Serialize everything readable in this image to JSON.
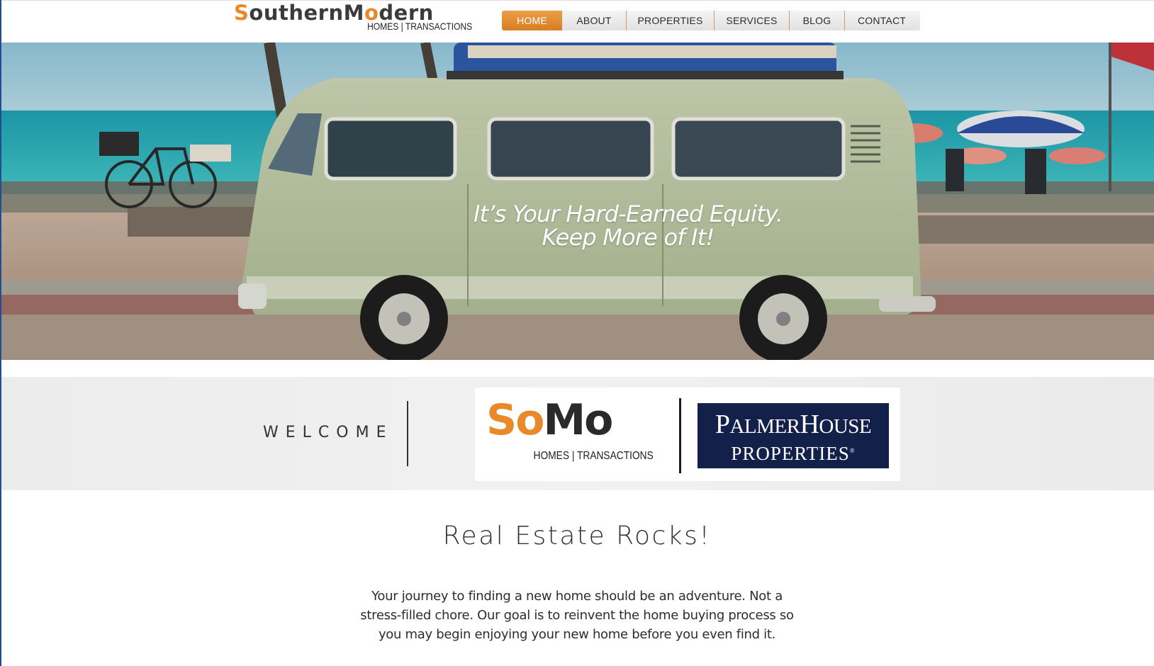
{
  "header": {
    "logo": {
      "word1_initial": "S",
      "word1_rest": "outhern",
      "word2_initial": "M",
      "word2_o": "o",
      "word2_rest": "dern",
      "tagline": "HOMES | TRANSACTIONS"
    },
    "nav": [
      {
        "label": "HOME",
        "active": true
      },
      {
        "label": "ABOUT",
        "active": false
      },
      {
        "label": "PROPERTIES",
        "active": false
      },
      {
        "label": "SERVICES",
        "active": false
      },
      {
        "label": "BLOG",
        "active": false
      },
      {
        "label": "CONTACT",
        "active": false
      }
    ]
  },
  "hero": {
    "line1": "It’s Your Hard-Earned Equity.",
    "line2": "Keep More of It!"
  },
  "welcome": {
    "label": "WELCOME",
    "somo": {
      "s": "S",
      "o1": "o",
      "m": "M",
      "o2": "o",
      "tagline": "HOMES | TRANSACTIONS"
    },
    "palmer": {
      "top_p": "P",
      "top_almer": "ALMER",
      "top_h": "H",
      "top_ouse": "OUSE",
      "bottom": "PROPERTIES",
      "reg": "®"
    }
  },
  "content": {
    "headline": "Real Estate Rocks!",
    "intro": "Your journey to finding a new home should be an adventure. Not a stress-filled chore. Our goal is to reinvent the home buying process so you may begin enjoying your new home before you even find it."
  },
  "colors": {
    "brand_orange": "#e8892a",
    "brand_navy": "#13214a",
    "nav_active": "#df8a2c"
  }
}
